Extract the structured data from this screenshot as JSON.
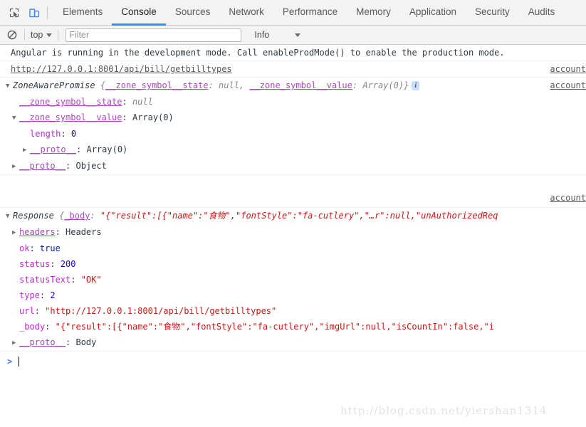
{
  "toolbar": {
    "inspect_icon": "inspect-element-icon",
    "device_icon": "device-toolbar-icon",
    "tabs": [
      {
        "label": "Elements",
        "active": false
      },
      {
        "label": "Console",
        "active": true
      },
      {
        "label": "Sources",
        "active": false
      },
      {
        "label": "Network",
        "active": false
      },
      {
        "label": "Performance",
        "active": false
      },
      {
        "label": "Memory",
        "active": false
      },
      {
        "label": "Application",
        "active": false
      },
      {
        "label": "Security",
        "active": false
      },
      {
        "label": "Audits",
        "active": false
      }
    ]
  },
  "console_toolbar": {
    "clear_icon": "clear-console-icon",
    "context": "top",
    "filter_placeholder": "Filter",
    "filter_value": "",
    "level": "Info"
  },
  "messages": {
    "angular_notice": "Angular is running in the development mode. Call enableProdMode() to enable the production mode.",
    "request_url": "http://127.0.0.1:8001/api/bill/getbilltypes",
    "anchor_1": "account",
    "anchor_2": "account",
    "anchor_3": "account",
    "promise": {
      "triangle_open": "▼",
      "class_name": "ZoneAwarePromise",
      "preview_open": "{",
      "preview_p1": "__zone_symbol__state",
      "preview_v1": "null",
      "preview_comma": ", ",
      "preview_p2": "__zone_symbol__value",
      "preview_v2": "Array(0)",
      "preview_close": "}",
      "info_badge": "i",
      "rows": [
        {
          "indent": 1,
          "triangle": "",
          "key": "__zone_symbol__state",
          "value": "null",
          "value_type": "null"
        },
        {
          "indent": 1,
          "triangle": "▼",
          "key": "__zone_symbol__value",
          "value": "Array(0)",
          "value_type": "plain"
        },
        {
          "indent": 2,
          "triangle": "",
          "key": "length",
          "value": "0",
          "value_type": "num"
        },
        {
          "indent": 2,
          "triangle": "▶",
          "key": "__proto__",
          "value": "Array(0)",
          "value_type": "plain"
        },
        {
          "indent": 1,
          "triangle": "▶",
          "key": "__proto__",
          "value": "Object",
          "value_type": "plain"
        }
      ]
    },
    "response": {
      "triangle_open": "▼",
      "class_name": "Response",
      "preview_open": "{",
      "preview_key": "_body",
      "preview_value": "\"{\"result\":[{\"name\":\"食物\",\"fontStyle\":\"fa-cutlery\",\"…r\":null,\"unAuthorizedReq",
      "rows": [
        {
          "indent": 1,
          "triangle": "▶",
          "key": "headers",
          "value": "Headers",
          "value_type": "plain"
        },
        {
          "indent": 1,
          "triangle": "",
          "key": "ok",
          "value": "true",
          "value_type": "bool"
        },
        {
          "indent": 1,
          "triangle": "",
          "key": "status",
          "value": "200",
          "value_type": "num"
        },
        {
          "indent": 1,
          "triangle": "",
          "key": "statusText",
          "value": "\"OK\"",
          "value_type": "str"
        },
        {
          "indent": 1,
          "triangle": "",
          "key": "type",
          "value": "2",
          "value_type": "num"
        },
        {
          "indent": 1,
          "triangle": "",
          "key": "url",
          "value": "\"http://127.0.0.1:8001/api/bill/getbilltypes\"",
          "value_type": "str"
        },
        {
          "indent": 1,
          "triangle": "",
          "key": "_body",
          "value": "\"{\"result\":[{\"name\":\"食物\",\"fontStyle\":\"fa-cutlery\",\"imgUrl\":null,\"isCountIn\":false,\"i",
          "value_type": "str"
        },
        {
          "indent": 1,
          "triangle": "▶",
          "key": "__proto__",
          "value": "Body",
          "value_type": "plain"
        }
      ]
    }
  },
  "prompt": {
    "arrow": ">",
    "value": ""
  },
  "watermark": "http://blog.csdn.net/yiershan1314",
  "colors": {
    "accent": "#4285f4",
    "property": "#c026d3",
    "string": "#c41a16",
    "number": "#1c00cf",
    "toolbar_bg": "#f3f3f3"
  }
}
